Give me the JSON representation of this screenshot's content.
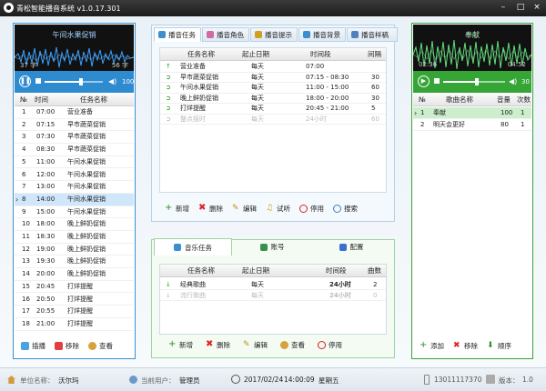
{
  "app": {
    "title": "青松智能播音系统 v1.0.17.301",
    "version": "v1.0.17.301",
    "brand_color": "#2e86c9"
  },
  "left_player": {
    "now_playing": "午间水果促销",
    "count_left": "37 字",
    "count_right": "56 字",
    "volume": "100",
    "volume_level": 0.62
  },
  "left_list": {
    "headers": [
      "№",
      "时间",
      "任务名称"
    ],
    "rows": [
      {
        "no": "1",
        "time": "07:00",
        "name": "营业准备"
      },
      {
        "no": "2",
        "time": "07:15",
        "name": "早市蔬菜促销"
      },
      {
        "no": "3",
        "time": "07:30",
        "name": "早市蔬菜促销"
      },
      {
        "no": "4",
        "time": "08:30",
        "name": "早市蔬菜促销"
      },
      {
        "no": "5",
        "time": "11:00",
        "name": "午间水果促销"
      },
      {
        "no": "6",
        "time": "12:00",
        "name": "午间水果促销"
      },
      {
        "no": "7",
        "time": "13:00",
        "name": "午间水果促销"
      },
      {
        "no": "8",
        "time": "14:00",
        "name": "午间水果促销"
      },
      {
        "no": "9",
        "time": "15:00",
        "name": "午间水果促销"
      },
      {
        "no": "10",
        "time": "18:00",
        "name": "晚上鲜奶促销"
      },
      {
        "no": "11",
        "time": "18:30",
        "name": "晚上鲜奶促销"
      },
      {
        "no": "12",
        "time": "19:00",
        "name": "晚上鲜奶促销"
      },
      {
        "no": "13",
        "time": "19:30",
        "name": "晚上鲜奶促销"
      },
      {
        "no": "14",
        "time": "20:00",
        "name": "晚上鲜奶促销"
      },
      {
        "no": "15",
        "time": "20:45",
        "name": "打烊提醒"
      },
      {
        "no": "16",
        "time": "20:50",
        "name": "打烊提醒"
      },
      {
        "no": "17",
        "time": "20:55",
        "name": "打烊提醒"
      },
      {
        "no": "18",
        "time": "21:00",
        "name": "打烊提醒"
      }
    ],
    "selected_index": 7,
    "buttons": {
      "insert": "插播",
      "remove": "移除",
      "view": "查看"
    }
  },
  "broadcast": {
    "tabs": [
      "播音任务",
      "播音角色",
      "播音提示",
      "播音背景",
      "播音样稿"
    ],
    "headers": [
      "任务名称",
      "起止日期",
      "时间段",
      "间隔"
    ],
    "rows": [
      {
        "name": "营业准备",
        "date": "每天",
        "period": "07:00",
        "interval": "",
        "disabled": false
      },
      {
        "name": "早市蔬菜促销",
        "date": "每天",
        "period": "07:15 - 08:30",
        "interval": "30",
        "disabled": false
      },
      {
        "name": "午间水果促销",
        "date": "每天",
        "period": "11:00 - 15:00",
        "interval": "60",
        "disabled": false
      },
      {
        "name": "晚上鲜奶促销",
        "date": "每天",
        "period": "18:00 - 20:00",
        "interval": "30",
        "disabled": false
      },
      {
        "name": "打烊提醒",
        "date": "每天",
        "period": "20:45 - 21:00",
        "interval": "5",
        "disabled": false
      },
      {
        "name": "整点报时",
        "date": "每天",
        "period": "24小时",
        "interval": "60",
        "disabled": true
      }
    ],
    "buttons": {
      "add": "新增",
      "delete": "删除",
      "edit": "编辑",
      "listen": "试听",
      "disable": "停用",
      "search": "搜索"
    }
  },
  "music_task": {
    "tabs": [
      "音乐任务",
      "账号",
      "配置"
    ],
    "headers": [
      "任务名称",
      "起止日期",
      "时间段",
      "曲数"
    ],
    "rows": [
      {
        "name": "经典歌曲",
        "date": "每天",
        "period": "24小时",
        "count": "2",
        "disabled": false
      },
      {
        "name": "流行歌曲",
        "date": "每天",
        "period": "24小时",
        "count": "0",
        "disabled": true
      }
    ],
    "buttons": {
      "add": "新增",
      "delete": "删除",
      "edit": "编辑",
      "view": "查看",
      "disable": "停用"
    }
  },
  "right_player": {
    "now_playing": "奉献",
    "time_left": "02:36",
    "time_right": "04:52",
    "volume": "30",
    "progress": 0.54,
    "volume_level": 0.42
  },
  "song_list": {
    "headers": [
      "№",
      "歌曲名称",
      "音量",
      "次数"
    ],
    "rows": [
      {
        "no": "1",
        "name": "奉献",
        "volume": "100",
        "count": "1"
      },
      {
        "no": "2",
        "name": "明天会更好",
        "volume": "80",
        "count": "1"
      }
    ],
    "selected_index": 0,
    "buttons": {
      "add": "添加",
      "remove": "移除",
      "order": "顺序"
    }
  },
  "status": {
    "unit_label": "单位名称：",
    "unit_value": "沃尔玛",
    "user_label": "当前用户：",
    "user_value": "管理员",
    "date": "2017/02/24",
    "time": "14:00:09",
    "weekday": "星期五",
    "phone": "13011117370",
    "version_label": "版本：",
    "version_value": "1.0"
  }
}
